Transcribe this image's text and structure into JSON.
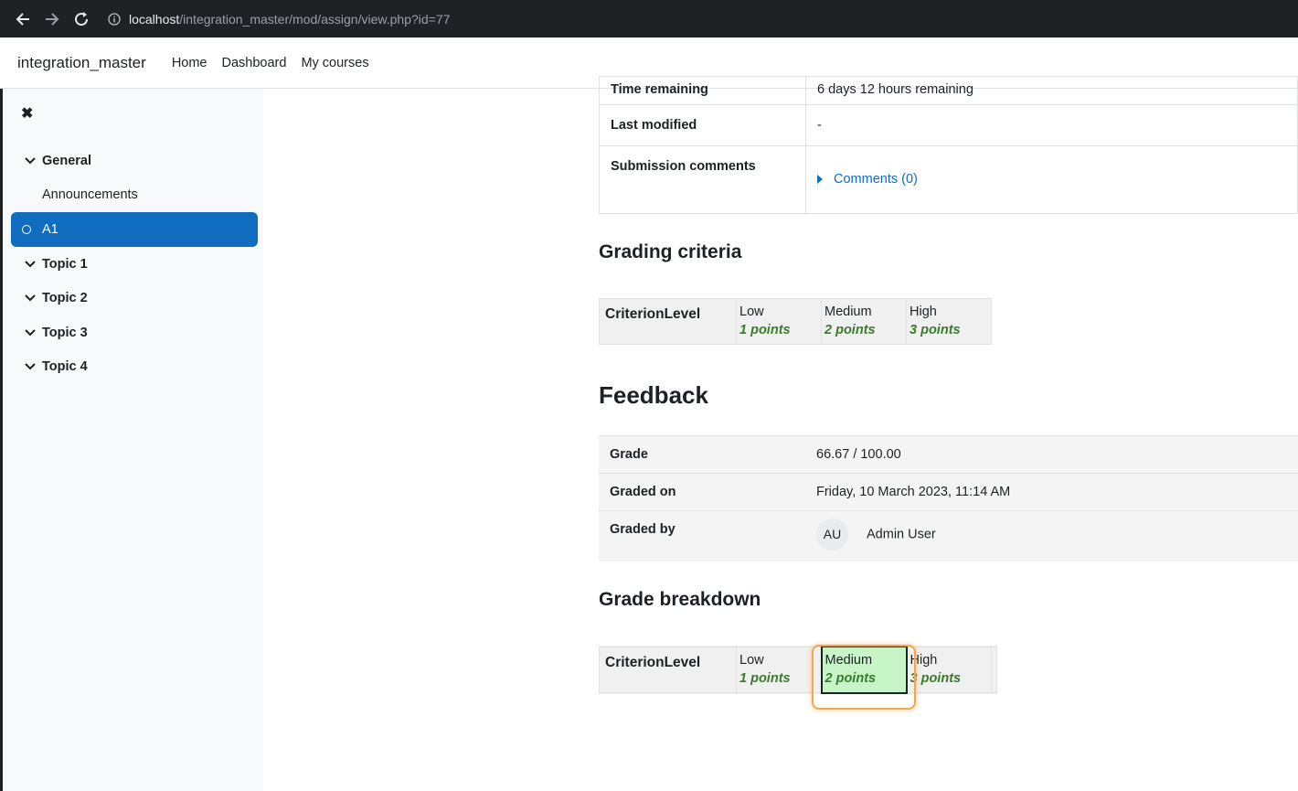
{
  "browser": {
    "url_host": "localhost",
    "url_path": "/integration_master/mod/assign/view.php?id=77"
  },
  "navbar": {
    "brand": "integration_master",
    "links": [
      "Home",
      "Dashboard",
      "My courses"
    ]
  },
  "course_index": {
    "close_glyph": "✖",
    "items": [
      {
        "type": "section",
        "label": "General"
      },
      {
        "type": "activity",
        "label": "Announcements",
        "active": false
      },
      {
        "type": "activity",
        "label": "A1",
        "active": true
      },
      {
        "type": "section",
        "label": "Topic 1"
      },
      {
        "type": "section",
        "label": "Topic 2"
      },
      {
        "type": "section",
        "label": "Topic 3"
      },
      {
        "type": "section",
        "label": "Topic 4"
      }
    ]
  },
  "submission_status": {
    "time_remaining_label": "Time remaining",
    "time_remaining_value": "6 days 12 hours remaining",
    "last_modified_label": "Last modified",
    "last_modified_value": "-",
    "submission_comments_label": "Submission comments",
    "comments_link": "Comments (0)"
  },
  "grading_criteria": {
    "heading": "Grading criteria",
    "criterion": "CriterionLevel",
    "levels": [
      {
        "name": "Low",
        "points": "1 points"
      },
      {
        "name": "Medium",
        "points": "2 points"
      },
      {
        "name": "High",
        "points": "3 points"
      }
    ]
  },
  "feedback": {
    "heading": "Feedback",
    "grade_label": "Grade",
    "grade_value": "66.67 / 100.00",
    "graded_on_label": "Graded on",
    "graded_on_value": "Friday, 10 March 2023, 11:14 AM",
    "graded_by_label": "Graded by",
    "grader_initials": "AU",
    "grader_name": "Admin User"
  },
  "grade_breakdown": {
    "heading": "Grade breakdown",
    "criterion": "CriterionLevel",
    "levels": [
      {
        "name": "Low",
        "points": "1 points",
        "selected": false
      },
      {
        "name": "Medium",
        "points": "2 points",
        "selected": true
      },
      {
        "name": "High",
        "points": "3 points",
        "selected": false
      }
    ]
  }
}
